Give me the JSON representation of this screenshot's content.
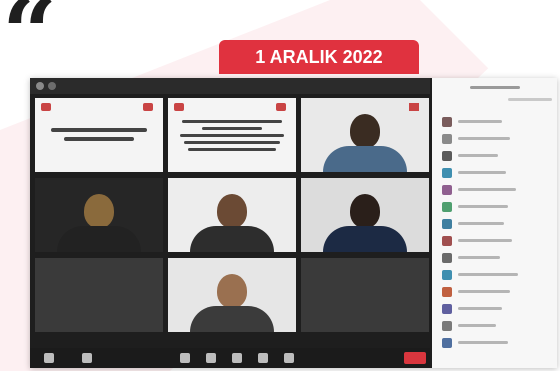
{
  "header": {
    "quote_mark": "“",
    "date_label": "1 ARALIK 2022"
  },
  "colors": {
    "accent": "#e0323f",
    "background_shape": "#fdf0f2"
  },
  "screenshot": {
    "window": "video-conference",
    "tiles": [
      {
        "kind": "slide"
      },
      {
        "kind": "slide"
      },
      {
        "kind": "video"
      },
      {
        "kind": "video"
      },
      {
        "kind": "video"
      },
      {
        "kind": "video"
      },
      {
        "kind": "video"
      }
    ],
    "participants_panel": {
      "row_count": 14
    }
  }
}
